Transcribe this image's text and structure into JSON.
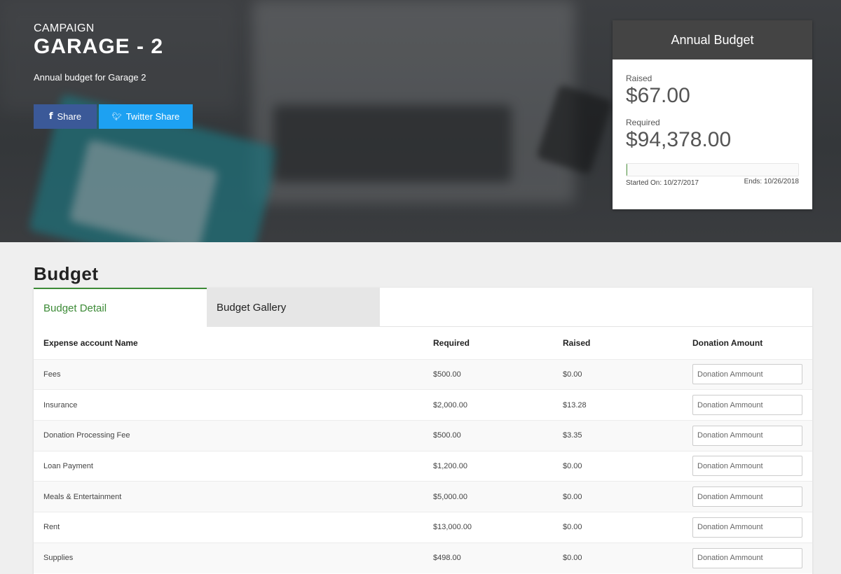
{
  "campaign": {
    "label": "CAMPAIGN",
    "title": "GARAGE - 2",
    "description": "Annual budget for Garage 2"
  },
  "share": {
    "facebook_label": "Share",
    "twitter_label": "Twitter Share",
    "facebook_icon": "facebook-icon",
    "twitter_icon": "twitter-icon"
  },
  "budget_card": {
    "title": "Annual Budget",
    "raised_label": "Raised",
    "raised_amount": "$67.00",
    "required_label": "Required",
    "required_amount": "$94,378.00",
    "progress_fraction": 0.0007,
    "started": "Started On: 10/27/2017",
    "ends": "Ends: 10/26/2018"
  },
  "section": {
    "title": "Budget"
  },
  "tabs": [
    {
      "label": "Budget Detail"
    },
    {
      "label": "Budget Gallery"
    }
  ],
  "table": {
    "headers": {
      "name": "Expense account Name",
      "required": "Required",
      "raised": "Raised",
      "donation": "Donation Amount"
    },
    "input_placeholder": "Donation Ammount",
    "rows": [
      {
        "name": "Fees",
        "required": "$500.00",
        "raised": "$0.00"
      },
      {
        "name": "Insurance",
        "required": "$2,000.00",
        "raised": "$13.28"
      },
      {
        "name": "Donation Processing Fee",
        "required": "$500.00",
        "raised": "$3.35"
      },
      {
        "name": "Loan Payment",
        "required": "$1,200.00",
        "raised": "$0.00"
      },
      {
        "name": "Meals & Entertainment",
        "required": "$5,000.00",
        "raised": "$0.00"
      },
      {
        "name": "Rent",
        "required": "$13,000.00",
        "raised": "$0.00"
      },
      {
        "name": "Supplies",
        "required": "$498.00",
        "raised": "$0.00"
      }
    ]
  },
  "colors": {
    "accent": "#3d8b37",
    "facebook": "#3b5998",
    "twitter": "#1da1f2",
    "card_header": "#444444"
  }
}
